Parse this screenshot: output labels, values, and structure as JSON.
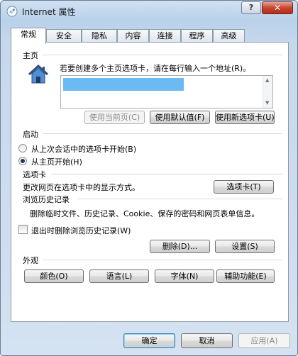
{
  "window": {
    "title": "Internet 属性",
    "help_label": "?",
    "close_label": "✕"
  },
  "tabs": [
    "常规",
    "安全",
    "隐私",
    "内容",
    "连接",
    "程序",
    "高级"
  ],
  "homepage": {
    "group_label": "主页",
    "description": "若要创建多个主页选项卡，请在每行输入一个地址(R)。",
    "url_value": "",
    "use_current_label": "使用当前页(C)",
    "use_default_label": "使用默认值(F)",
    "use_new_tab_label": "使用新选项卡(U)"
  },
  "startup": {
    "group_label": "启动",
    "option_last_session": "从上次会话中的选项卡开始(B)",
    "option_home_page": "从主页开始(H)",
    "selected": "option_home_page"
  },
  "tabs_group": {
    "group_label": "选项卡",
    "description": "更改网页在选项卡中的显示方式。",
    "button_label": "选项卡(T)"
  },
  "history": {
    "group_label": "浏览历史记录",
    "description": "删除临时文件、历史记录、Cookie、保存的密码和网页表单信息。",
    "checkbox_label": "退出时删除浏览历史记录(W)",
    "checkbox_checked": false,
    "delete_label": "删除(D)...",
    "settings_label": "设置(S)"
  },
  "appearance": {
    "group_label": "外观",
    "colors_label": "颜色(O)",
    "languages_label": "语言(L)",
    "fonts_label": "字体(N)",
    "accessibility_label": "辅助功能(E)"
  },
  "footer": {
    "ok_label": "确定",
    "cancel_label": "取消",
    "apply_label": "应用(A)"
  },
  "colors": {
    "accent": "#3ba3f0",
    "close": "#c9452f"
  }
}
